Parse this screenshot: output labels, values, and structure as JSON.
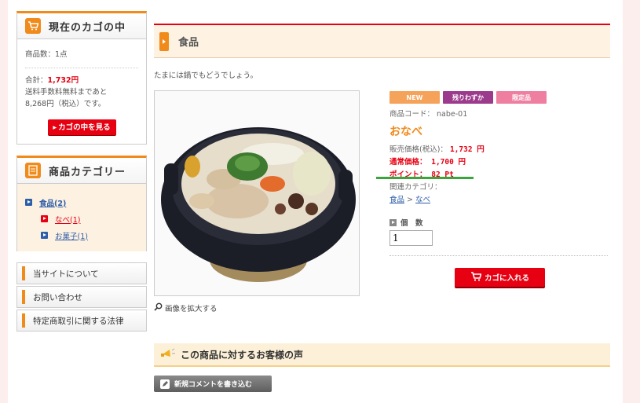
{
  "cart": {
    "title": "現在のカゴの中",
    "item_count": "商品数：1点",
    "total_label": "合計：",
    "total_value": "1,732円",
    "shipping_note_1": "送料手数料無料まであと",
    "shipping_note_2": "8,268円（税込）です。",
    "view_button": "カゴの中を見る"
  },
  "categories": {
    "title": "商品カテゴリー",
    "items": [
      {
        "label": "食品(2)"
      },
      {
        "label": "なべ(1)"
      },
      {
        "label": "お菓子(1)"
      }
    ]
  },
  "nav": {
    "items": [
      {
        "label": "当サイトについて"
      },
      {
        "label": "お問い合わせ"
      },
      {
        "label": "特定商取引に関する法律"
      }
    ]
  },
  "main": {
    "heading": "食品",
    "intro": "たまには鍋でもどうでしょう。",
    "zoom_link": "画像を拡大する",
    "tags": [
      {
        "label": "NEW",
        "color": "#f5a35a"
      },
      {
        "label": "残りわずか",
        "color": "#9c3a8c"
      },
      {
        "label": "限定品",
        "color": "#ef7fa1"
      }
    ],
    "product_code": "商品コード： nabe-01",
    "product_name": "おなべ",
    "sale_price_label": "販売価格(税込)：",
    "sale_price_value": "1,732 円",
    "normal_price": "通常価格： 1,700 円",
    "points": "ポイント： 82 Pt",
    "related_category_label": "関連カテゴリ：",
    "related_cat_1": "食品",
    "related_sep": ">",
    "related_cat_2": "なべ",
    "quantity_label": "個　数",
    "quantity_value": "1",
    "add_to_cart": "カゴに入れる"
  },
  "reviews": {
    "heading": "この商品に対するお客様の声",
    "new_comment_button": "新規コメントを書き込む"
  },
  "colors": {
    "accent_orange": "#f08a1a",
    "brand_red": "#e60012",
    "link_blue": "#2d5ea8"
  }
}
